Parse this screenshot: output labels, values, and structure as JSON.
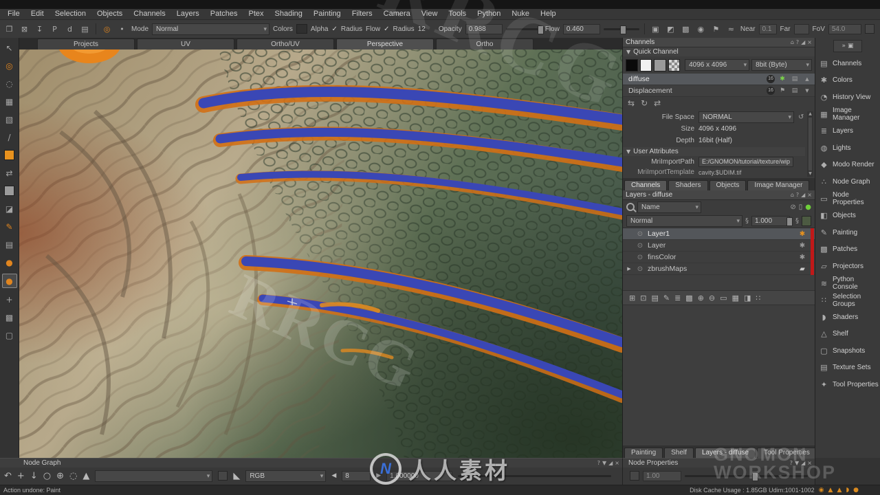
{
  "menu": {
    "items": [
      "File",
      "Edit",
      "Selection",
      "Objects",
      "Channels",
      "Layers",
      "Patches",
      "Ptex",
      "Shading",
      "Painting",
      "Filters",
      "Camera",
      "View",
      "Tools",
      "Python",
      "Nuke",
      "Help"
    ]
  },
  "toolbar": {
    "mode_label": "Mode",
    "mode_value": "Normal",
    "colors_label": "Colors",
    "alpha_label": "Alpha",
    "alpha_check": "✓",
    "radius_label": "Radius",
    "flow_label": "Flow",
    "flow_check": "✓",
    "radius2_label": "Radius",
    "radius2_value": "12",
    "opacity_label": "Opacity",
    "opacity_value": "0.988",
    "flow2_label": "Flow",
    "flow2_value": "0.460",
    "near_label": "Near",
    "near_value": "0.1",
    "far_label": "Far",
    "far_value": "",
    "fov_label": "FoV",
    "fov_value": "54.0"
  },
  "viewport_tabs": {
    "items": [
      "Projects",
      "UV",
      "Ortho/UV",
      "Perspective",
      "Ortho"
    ]
  },
  "channels": {
    "title": "Channels",
    "quick_channel_label": "Quick Channel",
    "resolution_value": "4096 x 4096",
    "bitdepth_value": "8bit (Byte)",
    "rows": [
      {
        "name": "diffuse",
        "badge": "16"
      },
      {
        "name": "Displacement",
        "badge": "16"
      }
    ],
    "file_space_label": "File Space",
    "file_space_value": "NORMAL",
    "size_label": "Size",
    "size_value": "4096 x 4096",
    "depth_label": "Depth",
    "depth_value": "16bit (Half)",
    "user_attributes_label": "User Attributes",
    "import_path_label": "MriImportPath",
    "import_path_value": "E:/GNOMON/tutorial/texture/wipMaps",
    "import_template_label": "MriImportTemplate",
    "import_template_value": "cavity.$UDIM.tif",
    "tabs": [
      "Channels",
      "Shaders",
      "Objects",
      "Image Manager"
    ]
  },
  "layers": {
    "title": "Layers - diffuse",
    "filter_value": "Name",
    "blend_mode_value": "Normal",
    "opacity_value": "1.000",
    "rows": [
      {
        "name": "Layer1"
      },
      {
        "name": "Layer"
      },
      {
        "name": "finsColor"
      },
      {
        "name": "zbrushMaps"
      }
    ]
  },
  "panel_tabs": {
    "items": [
      "Painting",
      "Shelf",
      "Layers - diffuse",
      "Tool Properties"
    ]
  },
  "sidebar": {
    "top_icons": [
      "»",
      "▣"
    ],
    "items": [
      {
        "label": "Channels",
        "glyph": "▤"
      },
      {
        "label": "Colors",
        "glyph": "✱"
      },
      {
        "label": "History View",
        "glyph": "◔"
      },
      {
        "label": "Image Manager",
        "glyph": "▦"
      },
      {
        "label": "Layers",
        "glyph": "≣"
      },
      {
        "label": "Lights",
        "glyph": "◍"
      },
      {
        "label": "Modo Render",
        "glyph": "◆"
      },
      {
        "label": "Node Graph",
        "glyph": "∴"
      },
      {
        "label": "Node Properties",
        "glyph": "▭"
      },
      {
        "label": "Objects",
        "glyph": "◧"
      },
      {
        "label": "Painting",
        "glyph": "✎"
      },
      {
        "label": "Patches",
        "glyph": "▩"
      },
      {
        "label": "Projectors",
        "glyph": "▱"
      },
      {
        "label": "Python Console",
        "glyph": "≋"
      },
      {
        "label": "Selection Groups",
        "glyph": "∷"
      },
      {
        "label": "Shaders",
        "glyph": "◗"
      },
      {
        "label": "Shelf",
        "glyph": "△"
      },
      {
        "label": "Snapshots",
        "glyph": "▢"
      },
      {
        "label": "Texture Sets",
        "glyph": "▤"
      },
      {
        "label": "Tool Properties",
        "glyph": "✦"
      }
    ]
  },
  "bottom": {
    "node_graph_title": "Node Graph",
    "node_properties_title": "Node Properties",
    "colorspace_value": "RGB",
    "frame_value": "8",
    "value_field": "1.000000",
    "np_value": "1.00",
    "status_left": "Action undone: Paint",
    "status_right": "Disk Cache Usage : 1.85GB Udim:1001-1002"
  },
  "icons": {
    "file_strip": [
      "❐",
      "⊠",
      "↧",
      "P",
      "d",
      "▤"
    ],
    "target_orange": "◎",
    "dot": "•",
    "view_strip": [
      "▣",
      "◩",
      "▩",
      "◉",
      "⚑",
      "≈"
    ],
    "panel": [
      "⌂",
      "?",
      "◢",
      "×"
    ],
    "quick_strip": [
      "⇆",
      "↻",
      "⇄"
    ],
    "reset": "↺",
    "link": "§",
    "search_icons": [
      "⊘",
      "▯",
      "●"
    ],
    "expander": "▶",
    "eye": "⊙",
    "splash": "✱",
    "folder": "▰",
    "layer_actions": [
      "⊞",
      "⊡",
      "▤",
      "✎",
      "≣",
      "▩",
      "⊕",
      "⊖",
      "▭",
      "▦",
      "◨",
      "∷"
    ],
    "bottom_strip": [
      "↶",
      "+",
      "↓",
      "○",
      "⊕",
      "◌",
      "▲"
    ],
    "k_icon": "◣",
    "prev": "◀",
    "next": "▶",
    "scroll_up": "▲",
    "scroll_down": "▼",
    "status_strip": [
      "◉",
      "▲",
      "▲",
      "◗",
      "●"
    ],
    "left_tools": [
      "↖",
      "◎",
      "◌",
      "▦",
      "▧",
      "/",
      "",
      "⇄",
      "",
      "◪",
      "✎",
      "▤",
      "●",
      "●",
      "+",
      "▩",
      "▢"
    ]
  },
  "watermarks": {
    "rrcg_top": "RRCG",
    "rrcg_mid": "RRCG",
    "cn_logo_letter": "N",
    "cn_name": "人人素材",
    "gnomon_line1": "GNOMON",
    "gnomon_line2": "WORKSHOP"
  }
}
